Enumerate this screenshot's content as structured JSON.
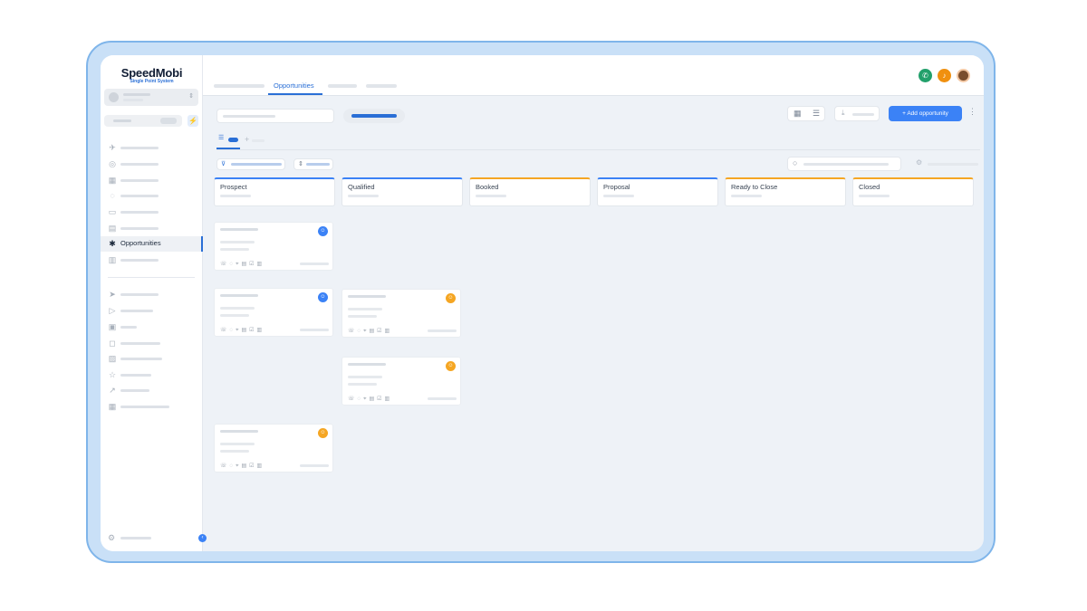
{
  "brand": {
    "name": "SpeedMobi",
    "tagline": "Single Point System"
  },
  "topbar": {
    "active_tab": "Opportunities"
  },
  "sidebar": {
    "active_item": "Opportunities"
  },
  "toolbar": {
    "add_label": "Add opportunity"
  },
  "pipeline": {
    "stages": [
      {
        "name": "Prospect",
        "color": "#3b82f6"
      },
      {
        "name": "Qualified",
        "color": "#3b82f6"
      },
      {
        "name": "Booked",
        "color": "#f5a623"
      },
      {
        "name": "Proposal",
        "color": "#3b82f6"
      },
      {
        "name": "Ready to Close",
        "color": "#f5a623"
      },
      {
        "name": "Closed",
        "color": "#f5a623"
      }
    ]
  },
  "colors": {
    "accent": "#2a6fd6",
    "button": "#3b82f6",
    "call": "#22a06b",
    "alert": "#f0900f",
    "warning": "#f5a623"
  },
  "icons": {
    "call": "phone-icon",
    "alert": "bell-icon",
    "user": "user-icon"
  }
}
